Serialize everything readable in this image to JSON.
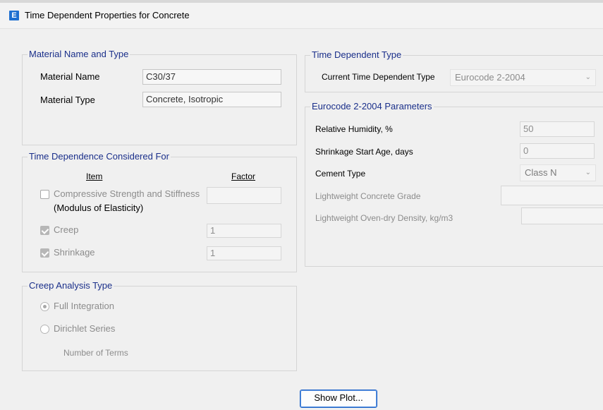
{
  "window": {
    "title": "Time Dependent Properties for Concrete",
    "icon_letter": "E"
  },
  "material_group": {
    "legend": "Material Name and Type",
    "name_label": "Material Name",
    "name_value": "C30/37",
    "type_label": "Material Type",
    "type_value": "Concrete, Isotropic"
  },
  "dependence_group": {
    "legend": "Time Dependence Considered For",
    "item_header": "Item",
    "factor_header": "Factor",
    "rows": [
      {
        "label": "Compressive Strength and Stiffness",
        "sublabel": "(Modulus of Elasticity)",
        "checked": false,
        "factor": ""
      },
      {
        "label": "Creep",
        "checked": true,
        "factor": "1"
      },
      {
        "label": "Shrinkage",
        "checked": true,
        "factor": "1"
      }
    ]
  },
  "creep_group": {
    "legend": "Creep Analysis Type",
    "options": [
      {
        "label": "Full Integration",
        "selected": true
      },
      {
        "label": "Dirichlet Series",
        "selected": false
      }
    ],
    "terms_label": "Number of Terms"
  },
  "td_type_group": {
    "legend": "Time Dependent Type",
    "current_label": "Current Time Dependent Type",
    "current_value": "Eurocode 2-2004"
  },
  "params_group": {
    "legend": "Eurocode 2-2004 Parameters",
    "humidity_label": "Relative Humidity, %",
    "humidity_value": "50",
    "shrink_age_label": "Shrinkage Start Age, days",
    "shrink_age_value": "0",
    "cement_label": "Cement Type",
    "cement_value": "Class N",
    "lw_grade_label": "Lightweight Concrete Grade",
    "lw_density_label": "Lightweight Oven-dry Density, kg/m3"
  },
  "buttons": {
    "show_plot": "Show Plot..."
  }
}
